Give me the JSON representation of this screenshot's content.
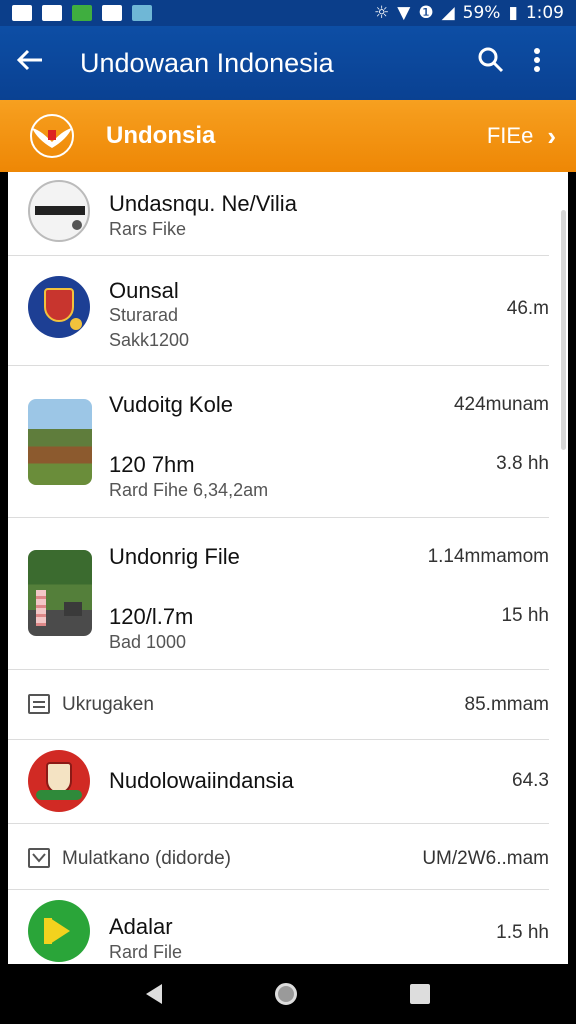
{
  "status_bar": {
    "battery_percent": "59%",
    "time": "1:09",
    "icons": [
      "image-icon",
      "chart-icon",
      "photo-icon",
      "notification-icon",
      "app-icon",
      "vibrate-icon",
      "wifi-icon",
      "sync-icon",
      "signal-icon",
      "battery-icon"
    ]
  },
  "app_bar": {
    "title": "Undowaan Indonesia",
    "back_icon": "arrow-left-icon",
    "search_icon": "search-icon",
    "menu_icon": "more-vertical-icon"
  },
  "banner": {
    "title": "Undonsia",
    "link_label": "FIEe",
    "emblem_icon": "garuda-emblem-icon",
    "color": "#f29212"
  },
  "items": [
    {
      "title": "Undasnqu. Ne/Vilia",
      "subtitle": "Rars Fike",
      "thumb": "device-icon"
    },
    {
      "title": "Ounsal",
      "subtitle": "Sturarad",
      "subtitle2": "Sakk1200",
      "right": "46.m",
      "thumb": "coat-of-arms-icon"
    },
    {
      "title": "Vudoitg Kole",
      "right": "424munam",
      "line2": "120 7hm",
      "right2": "3.8 hh",
      "line3": "Rard Fihe  6,34,2am",
      "thumb": "field-photo"
    },
    {
      "title": "Undonrig File",
      "right": "1.14mmamom",
      "line2": "120/l.7m",
      "right2": "15 hh",
      "line3": "Bad 1000",
      "thumb": "garden-photo"
    },
    {
      "section": "Ukrugaken",
      "right": "85.mmam",
      "icon": "list-icon"
    },
    {
      "title": "Nudolowaiindansia",
      "right": "64.3",
      "thumb": "red-emblem-icon"
    },
    {
      "section": "Mulatkano (didorde)",
      "right": "UM/2W6..mam",
      "icon": "check-box-icon"
    },
    {
      "title": "Adalar",
      "subtitle": "Rard File",
      "right": "1.5 hh",
      "thumb": "green-circle-icon"
    }
  ],
  "nav_bar": {
    "back": "back-triangle-icon",
    "home": "home-circle-icon",
    "recents": "recents-square-icon"
  }
}
